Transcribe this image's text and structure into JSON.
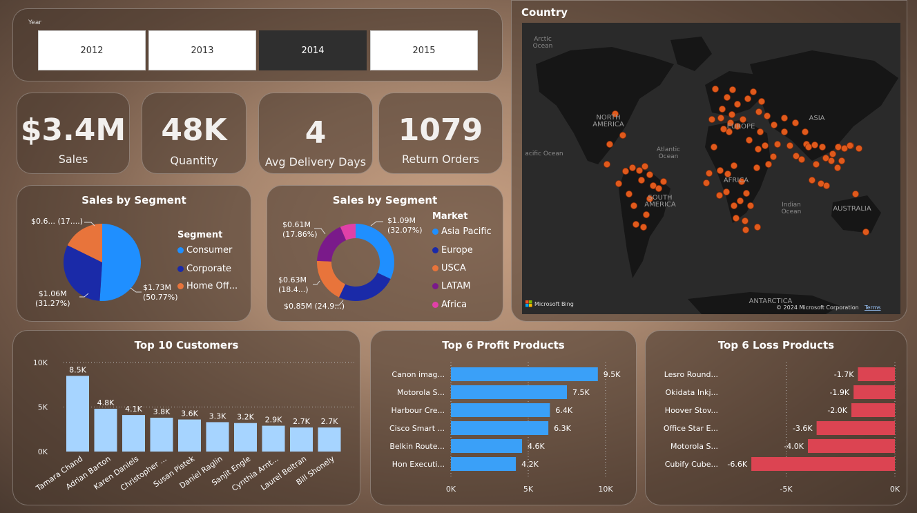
{
  "colors": {
    "primary_blue": "#1f8fff",
    "navy": "#1a2aa8",
    "orange": "#e8743b",
    "purple": "#7a1a8a",
    "pink": "#e040a8",
    "bar_light": "#a6d4ff",
    "bar_blue": "#3aa0f8",
    "bar_red": "#dc4452",
    "map_dot": "#e05a1c"
  },
  "year_slicer": {
    "label": "Year",
    "options": [
      "2012",
      "2013",
      "2014",
      "2015"
    ],
    "selected": "2014"
  },
  "kpis": [
    {
      "value": "$3.4M",
      "label": "Sales"
    },
    {
      "value": "48K",
      "label": "Quantity"
    },
    {
      "value": "4",
      "label": "Avg Delivery Days"
    },
    {
      "value": "1079",
      "label": "Return Orders"
    }
  ],
  "map": {
    "title": "Country",
    "labels": {
      "arctic": "Arctic\nOcean",
      "na": "NORTH\nAMERICA",
      "pacific": "acific Ocean",
      "atlantic": "Atlantic\nOcean",
      "europe": "EUROPE",
      "asia": "ASIA",
      "africa": "AFRICA",
      "sa": "SOUTH\nAMERICA",
      "indian": "Indian\nOcean",
      "australia": "AUSTRALIA",
      "antarctica": "ANTARCTICA"
    },
    "attribution": {
      "brand": "Microsoft Bing",
      "copyright": "© 2024 Microsoft Corporation",
      "terms": "Terms"
    }
  },
  "segment_pie": {
    "title": "Sales by Segment",
    "legend_title": "Segment",
    "legend": [
      "Consumer",
      "Corporate",
      "Home Off..."
    ],
    "labels": {
      "consumer": "$1.73M\n(50.77%)",
      "corporate": "$1.06M\n(31.27%)",
      "home": "$0.6... (17....)"
    }
  },
  "market_donut": {
    "title": "Sales by Segment",
    "legend_title": "Market",
    "legend": [
      "Asia Pacific",
      "Europe",
      "USCA",
      "LATAM",
      "Africa"
    ],
    "labels": {
      "asia": "$1.09M\n(32.07%)",
      "europe": "$0.85M (24.9...)",
      "usca": "$0.63M\n(18.4...)",
      "latam": "$0.61M\n(17.86%)"
    }
  },
  "top_customers": {
    "title": "Top 10 Customers",
    "y_ticks": [
      "10K",
      "5K",
      "0K"
    ]
  },
  "top_profit": {
    "title": "Top 6 Profit Products",
    "x_ticks": [
      "0K",
      "5K",
      "10K"
    ]
  },
  "top_loss": {
    "title": "Top 6 Loss Products",
    "x_ticks": [
      "-5K",
      "0K"
    ]
  },
  "chart_data": [
    {
      "type": "pie",
      "title": "Sales by Segment",
      "categories": [
        "Consumer",
        "Corporate",
        "Home Office"
      ],
      "values": [
        1.73,
        1.06,
        0.6
      ],
      "percent": [
        50.77,
        31.27,
        17.96
      ],
      "unit": "$M"
    },
    {
      "type": "pie",
      "title": "Sales by Segment",
      "categories": [
        "Asia Pacific",
        "Europe",
        "USCA",
        "LATAM",
        "Africa"
      ],
      "values": [
        1.09,
        0.85,
        0.63,
        0.61,
        0.22
      ],
      "percent": [
        32.07,
        24.9,
        18.4,
        17.86,
        6.77
      ],
      "unit": "$M",
      "donut": true
    },
    {
      "type": "bar",
      "title": "Top 10 Customers",
      "categories": [
        "Tamara Chand",
        "Adrian Barton",
        "Karen Daniels",
        "Christopher ...",
        "Susan Pistek",
        "Daniel Raglin",
        "Sanjit Engle",
        "Cynthia Arnt...",
        "Laurel Beltran",
        "Bill Shonely"
      ],
      "values": [
        8.5,
        4.8,
        4.1,
        3.8,
        3.6,
        3.3,
        3.2,
        2.9,
        2.7,
        2.7
      ],
      "value_labels": [
        "8.5K",
        "4.8K",
        "4.1K",
        "3.8K",
        "3.6K",
        "3.3K",
        "3.2K",
        "2.9K",
        "2.7K",
        "2.7K"
      ],
      "ylim": [
        0,
        10
      ],
      "unit": "K"
    },
    {
      "type": "bar",
      "orientation": "horizontal",
      "title": "Top 6 Profit Products",
      "categories": [
        "Canon imag...",
        "Motorola S...",
        "Harbour Cre...",
        "Cisco Smart ...",
        "Belkin Route...",
        "Hon Executi..."
      ],
      "values": [
        9.5,
        7.5,
        6.4,
        6.3,
        4.6,
        4.2
      ],
      "value_labels": [
        "9.5K",
        "7.5K",
        "6.4K",
        "6.3K",
        "4.6K",
        "4.2K"
      ],
      "xlim": [
        0,
        10
      ],
      "unit": "K"
    },
    {
      "type": "bar",
      "orientation": "horizontal",
      "title": "Top 6 Loss Products",
      "categories": [
        "Lesro Round...",
        "Okidata Inkj...",
        "Hoover Stov...",
        "Office Star E...",
        "Motorola S...",
        "Cubify Cube..."
      ],
      "values": [
        -1.7,
        -1.9,
        -2.0,
        -3.6,
        -4.0,
        -6.6
      ],
      "value_labels": [
        "-1.7K",
        "-1.9K",
        "-2.0K",
        "-3.6K",
        "-4.0K",
        "-6.6K"
      ],
      "xlim": [
        -7,
        0
      ],
      "unit": "K"
    }
  ]
}
